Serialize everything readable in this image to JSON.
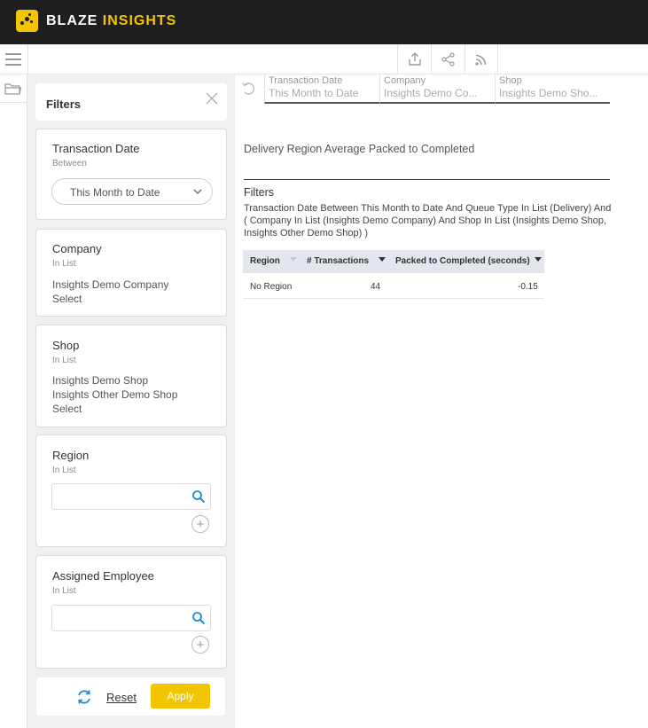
{
  "app": {
    "brand_word1": "BLAZE",
    "brand_word2": "INSIGHTS",
    "accent_color": "#f2c500",
    "topbar_color": "#1e1e1e"
  },
  "toolbar": {
    "icons": [
      "menu-icon",
      "export-icon",
      "share-icon",
      "rss-icon"
    ]
  },
  "filters_panel": {
    "title": "Filters",
    "cards": [
      {
        "title": "Transaction Date",
        "operator": "Between",
        "selected": "This Month to Date"
      },
      {
        "title": "Company",
        "operator": "In List",
        "values": [
          "Insights Demo Company",
          "Select"
        ]
      },
      {
        "title": "Shop",
        "operator": "In List",
        "values": [
          "Insights Demo Shop",
          "Insights Other Demo Shop",
          "Select"
        ]
      },
      {
        "title": "Region",
        "operator": "In List",
        "search_value": ""
      },
      {
        "title": "Assigned Employee",
        "operator": "In List",
        "search_value": ""
      }
    ],
    "reset_label": "Reset",
    "apply_label": "Apply"
  },
  "breadcrumbs": [
    {
      "label": "Transaction Date",
      "value": "This Month to Date"
    },
    {
      "label": "Company",
      "value": "Insights Demo Co..."
    },
    {
      "label": "Shop",
      "value": "Insights Demo Sho..."
    }
  ],
  "report": {
    "title": "Delivery Region Average Packed to Completed",
    "filters_label": "Filters",
    "filters_description": "Transaction Date Between This Month to Date And Queue Type In List (Delivery) And ( Company In List (Insights Demo Company) And Shop In List (Insights Demo Shop, Insights Other Demo Shop) )",
    "table": {
      "columns": [
        "Region",
        "# Transactions",
        "Packed to Completed (seconds)"
      ],
      "rows": [
        [
          "No Region",
          "44",
          "-0.15"
        ]
      ]
    }
  }
}
